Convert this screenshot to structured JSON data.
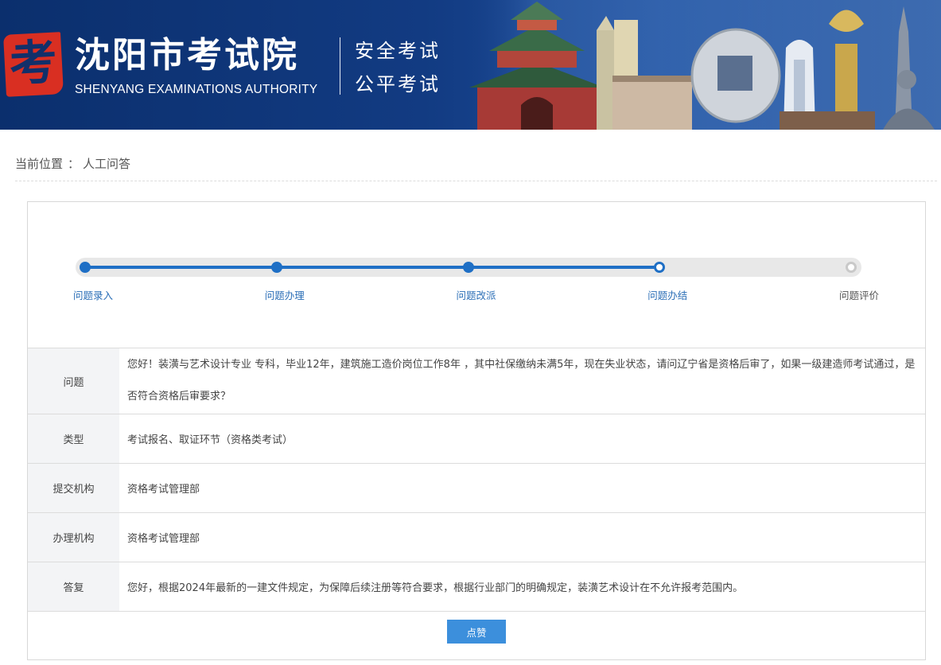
{
  "header": {
    "logo_char": "考",
    "title": "沈阳市考试院",
    "title_en": "SHENYANG EXAMINATIONS AUTHORITY",
    "slogan_1": "安全考试",
    "slogan_2": "公平考试",
    "banner_colors": {
      "primary": "#123b82",
      "logo_red": "#d92f22"
    }
  },
  "breadcrumb": {
    "prefix": "当前位置",
    "separator": "：",
    "current": "人工问答"
  },
  "progress": {
    "steps": [
      {
        "label": "问题录入",
        "state": "done"
      },
      {
        "label": "问题办理",
        "state": "done"
      },
      {
        "label": "问题改派",
        "state": "done"
      },
      {
        "label": "问题办结",
        "state": "current"
      },
      {
        "label": "问题评价",
        "state": "todo"
      }
    ],
    "completed_fraction": 0.75,
    "accent_color": "#1f6fc5"
  },
  "details": {
    "question": {
      "label": "问题",
      "value": "您好！装潢与艺术设计专业 专科，毕业12年，建筑施工造价岗位工作8年 ，其中社保缴纳未满5年，现在失业状态，请问辽宁省是资格后审了，如果一级建造师考试通过，是否符合资格后审要求？"
    },
    "type": {
      "label": "类型",
      "value": "考试报名、取证环节（资格类考试）"
    },
    "submit_org": {
      "label": "提交机构",
      "value": "资格考试管理部"
    },
    "handle_org": {
      "label": "办理机构",
      "value": "资格考试管理部"
    },
    "reply": {
      "label": "答复",
      "value": "您好，根据2024年最新的一建文件规定，为保障后续注册等符合要求，根据行业部门的明确规定，装潢艺术设计在不允许报考范围内。"
    }
  },
  "actions": {
    "like_label": "点赞",
    "like_color": "#3c8fdc"
  }
}
